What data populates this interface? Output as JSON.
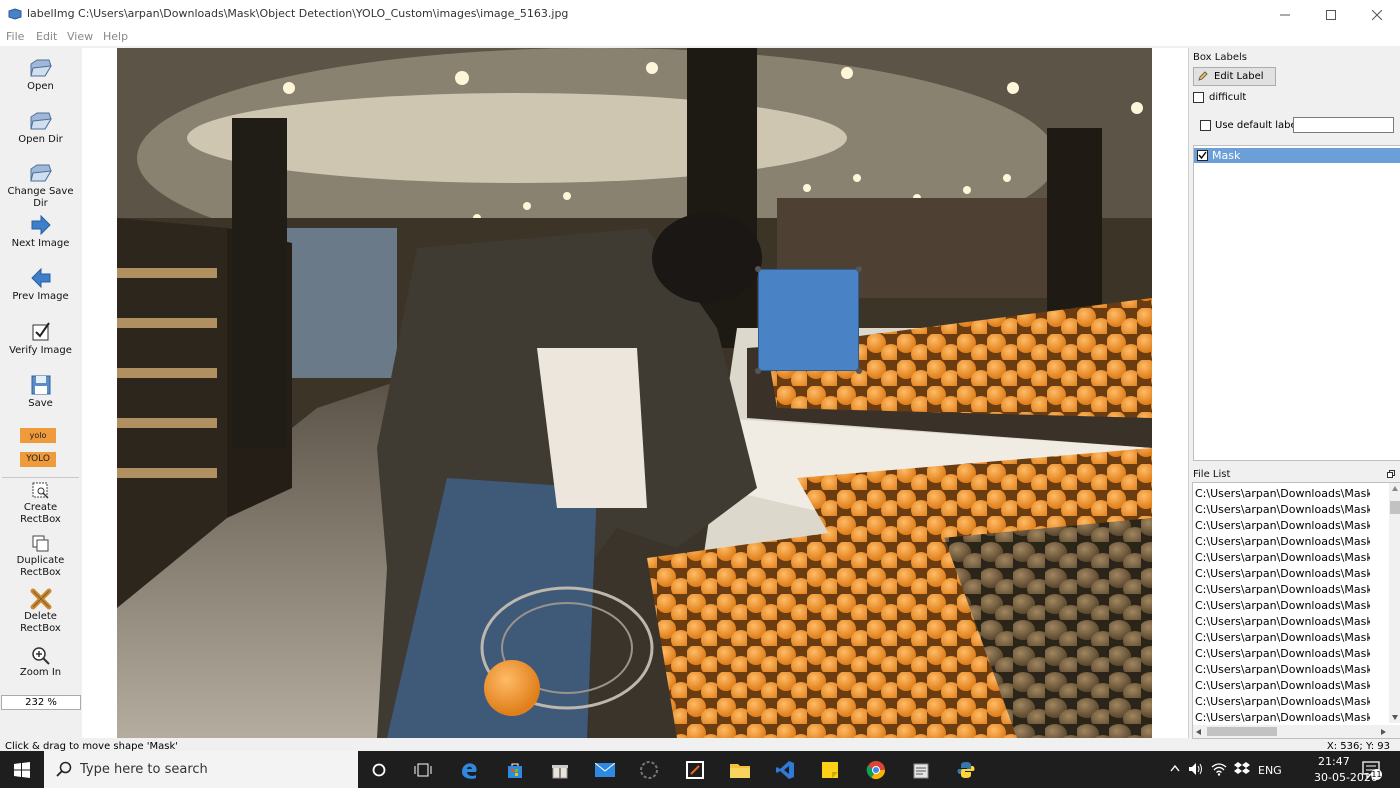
{
  "window": {
    "title": "labelImg C:\\Users\\arpan\\Downloads\\Mask\\Object Detection\\YOLO_Custom\\images\\image_5163.jpg"
  },
  "menu": [
    "File",
    "Edit",
    "View",
    "Help"
  ],
  "toolbar": {
    "open": "Open",
    "open_dir": "Open Dir",
    "change_save_dir": "Change Save Dir",
    "next_image": "Next Image",
    "prev_image": "Prev Image",
    "verify_image": "Verify Image",
    "save": "Save",
    "format_small": "yolo",
    "format_badge": "YOLO",
    "create_rectbox": [
      "Create",
      "RectBox"
    ],
    "duplicate_rectbox": [
      "Duplicate",
      "RectBox"
    ],
    "delete_rectbox": [
      "Delete",
      "RectBox"
    ],
    "zoom_in": "Zoom In",
    "zoom_value": "232 %"
  },
  "box_labels": {
    "title": "Box Labels",
    "edit_label": "Edit Label",
    "difficult": "difficult",
    "use_default_label": "Use default label",
    "default_label_value": "",
    "labels": [
      {
        "name": "Mask",
        "checked": true,
        "selected": true
      }
    ]
  },
  "file_list": {
    "title": "File List",
    "items": [
      "C:\\Users\\arpan\\Downloads\\Mask\\Obje",
      "C:\\Users\\arpan\\Downloads\\Mask\\Obje",
      "C:\\Users\\arpan\\Downloads\\Mask\\Obje",
      "C:\\Users\\arpan\\Downloads\\Mask\\Obje",
      "C:\\Users\\arpan\\Downloads\\Mask\\Obje",
      "C:\\Users\\arpan\\Downloads\\Mask\\Obje",
      "C:\\Users\\arpan\\Downloads\\Mask\\Obje",
      "C:\\Users\\arpan\\Downloads\\Mask\\Obje",
      "C:\\Users\\arpan\\Downloads\\Mask\\Obje",
      "C:\\Users\\arpan\\Downloads\\Mask\\Obje",
      "C:\\Users\\arpan\\Downloads\\Mask\\Obje",
      "C:\\Users\\arpan\\Downloads\\Mask\\Obje",
      "C:\\Users\\arpan\\Downloads\\Mask\\Obje",
      "C:\\Users\\arpan\\Downloads\\Mask\\Obje",
      "C:\\Users\\arpan\\Downloads\\Mask\\Obje"
    ]
  },
  "status": {
    "message": "Click & drag to move shape 'Mask'",
    "coords": "X: 536; Y: 93"
  },
  "taskbar": {
    "search_placeholder": "Type here to search",
    "language": "ENG",
    "time": "21:47",
    "date": "30-05-2020",
    "notification_count": "11"
  },
  "colors": {
    "label_highlight": "#6c9fd8",
    "bbox_fill": "#4a82c6",
    "yolo_badge": "#ef9b3b",
    "taskbar": "#1e1e1e"
  }
}
